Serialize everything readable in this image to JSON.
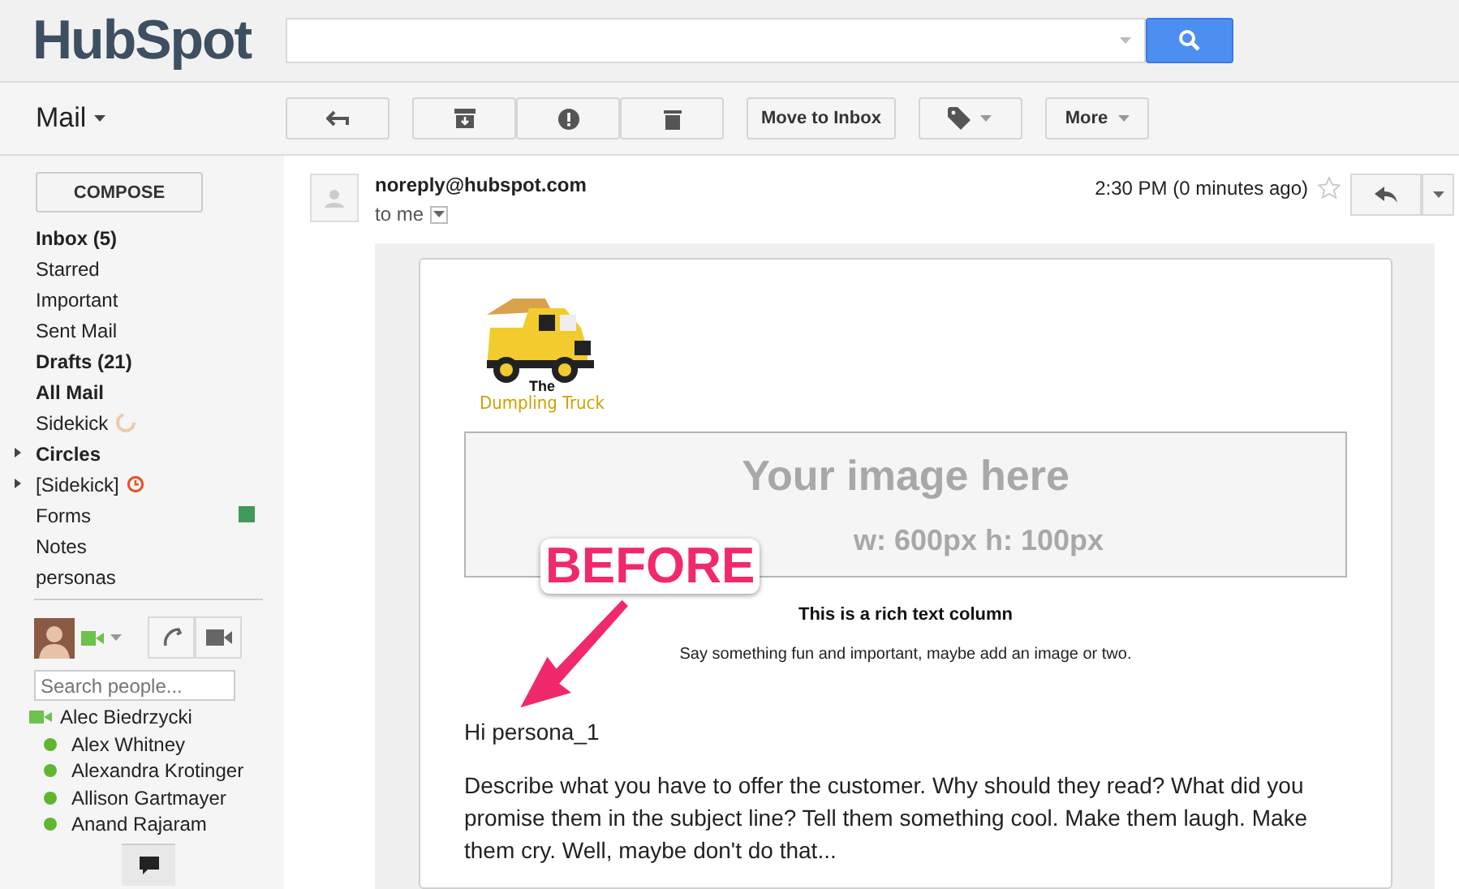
{
  "logo": {
    "text": "HubSpot"
  },
  "app_switcher": {
    "label": "Mail"
  },
  "toolbar": {
    "move_to_inbox": "Move to Inbox",
    "more": "More"
  },
  "compose": "COMPOSE",
  "sidebar": {
    "items": [
      {
        "label": "Inbox (5)",
        "bold": true,
        "kind": "plain"
      },
      {
        "label": "Starred",
        "bold": false,
        "kind": "plain"
      },
      {
        "label": "Important",
        "bold": false,
        "kind": "plain"
      },
      {
        "label": "Sent Mail",
        "bold": false,
        "kind": "plain"
      },
      {
        "label": "Drafts (21)",
        "bold": true,
        "kind": "plain"
      },
      {
        "label": "All Mail",
        "bold": true,
        "kind": "plain"
      },
      {
        "label": "Sidekick",
        "bold": false,
        "kind": "spinner"
      },
      {
        "label": "Circles",
        "bold": true,
        "kind": "expandable"
      },
      {
        "label": "[Sidekick]",
        "bold": false,
        "kind": "expandable-alarm"
      },
      {
        "label": "Forms",
        "bold": false,
        "kind": "labeled",
        "color": "#3e9b58"
      },
      {
        "label": "Notes",
        "bold": false,
        "kind": "plain"
      },
      {
        "label": "personas",
        "bold": false,
        "kind": "plain"
      }
    ]
  },
  "people_search": {
    "placeholder": "Search people..."
  },
  "contacts": [
    {
      "name": "Alec Biedrzycki",
      "kind": "video"
    },
    {
      "name": "Alex Whitney",
      "kind": "online"
    },
    {
      "name": "Alexandra Krotinger",
      "kind": "online"
    },
    {
      "name": "Allison Gartmayer",
      "kind": "online"
    },
    {
      "name": "Anand Rajaram",
      "kind": "online"
    }
  ],
  "message": {
    "sender": "noreply@hubspot.com",
    "recipient": "to me",
    "time": "2:30 PM (0 minutes ago)",
    "starred": false
  },
  "email": {
    "logo_small": "The",
    "logo_name": "Dumpling Truck",
    "image_title": "Your image here",
    "image_size": "w: 600px  h: 100px",
    "column_title": "This is a rich text column",
    "column_text": "Say something fun and important, maybe add an image or two.",
    "greeting": "Hi persona_1",
    "body": "Describe what you have to offer the customer. Why should they read? What did you promise them in the subject line? Tell them something cool. Make them laugh. Make them cry. Well, maybe don't do that..."
  },
  "callout": "BEFORE"
}
